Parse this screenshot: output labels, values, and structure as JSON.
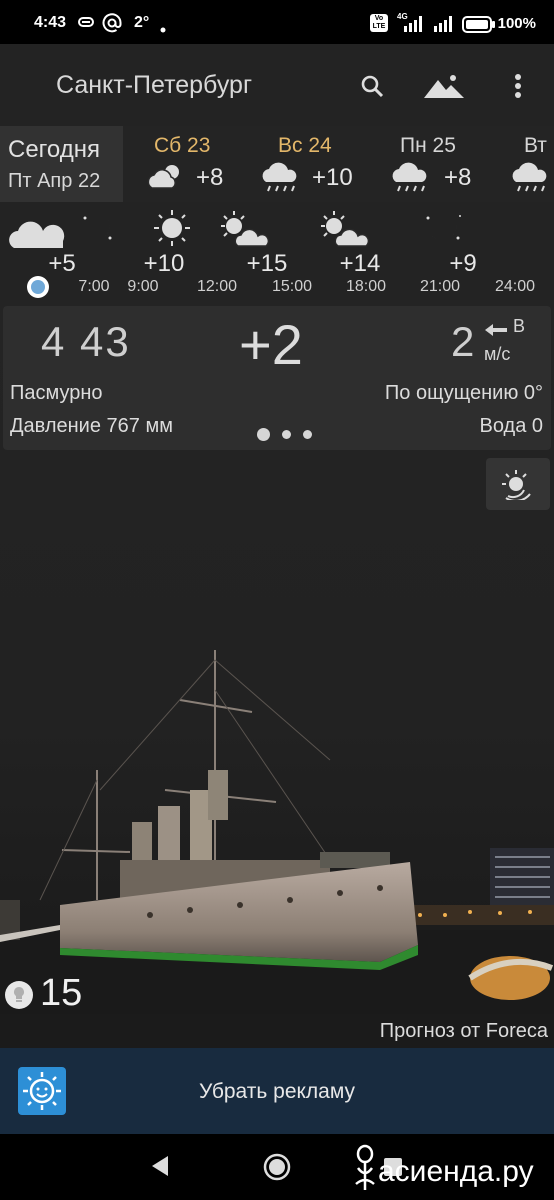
{
  "status_bar": {
    "time": "4:43",
    "notif_temp": "2°",
    "network_badge": "4G",
    "volte_badge": "Vo LTE",
    "battery": "100%",
    "icons": [
      "link-icon",
      "at-icon",
      "dot-icon",
      "signal-icon",
      "battery-icon"
    ]
  },
  "app_bar": {
    "city": "Санкт-Петербург",
    "actions": [
      "search-icon",
      "landscape-icon",
      "more-icon"
    ]
  },
  "daily": {
    "today": {
      "name": "Сегодня",
      "date": "Пт Апр 22"
    },
    "days": [
      {
        "label": "Сб 23",
        "temp": "+8",
        "icon": "partly-cloudy-icon",
        "color": "#e3b76a"
      },
      {
        "label": "Вс 24",
        "temp": "+10",
        "icon": "rain-icon",
        "color": "#e3b76a"
      },
      {
        "label": "Пн 25",
        "temp": "+8",
        "icon": "rain-icon",
        "color": "#d6d6d6"
      },
      {
        "label": "Вт",
        "temp": "",
        "icon": "rain-icon",
        "color": "#d6d6d6"
      }
    ]
  },
  "hourly": {
    "temps": [
      "+5",
      "+10",
      "+15",
      "+14",
      "+9"
    ],
    "icons": [
      "cloud-moon-icon",
      "sun-icon",
      "sun-cloud-icon",
      "sun-cloud-icon",
      "moon-icon"
    ],
    "times": [
      "7:00",
      "9:00",
      "12:00",
      "15:00",
      "18:00",
      "21:00",
      "24:00"
    ]
  },
  "current": {
    "time": "4 43",
    "temp": "+2",
    "wind_speed": "2",
    "wind_dir": "В",
    "wind_unit": "м/с",
    "condition": "Пасмурно",
    "feels_like": "По ощущению 0°",
    "pressure": "Давление 767 мм",
    "water": "Вода 0"
  },
  "uv": {
    "value": "15",
    "icon": "bulb-icon"
  },
  "credit": "Прогноз от Foreca",
  "ad": {
    "label": "Убрать рекламу",
    "icon": "sun-face-icon"
  },
  "nav": {
    "buttons": [
      "back-icon",
      "home-icon",
      "recents-icon"
    ]
  },
  "watermark": "асиенда.ру",
  "colors": {
    "accent_day": "#e3b76a",
    "ad_bar": "#182b3f",
    "now_dot": "#6fa8d8"
  }
}
